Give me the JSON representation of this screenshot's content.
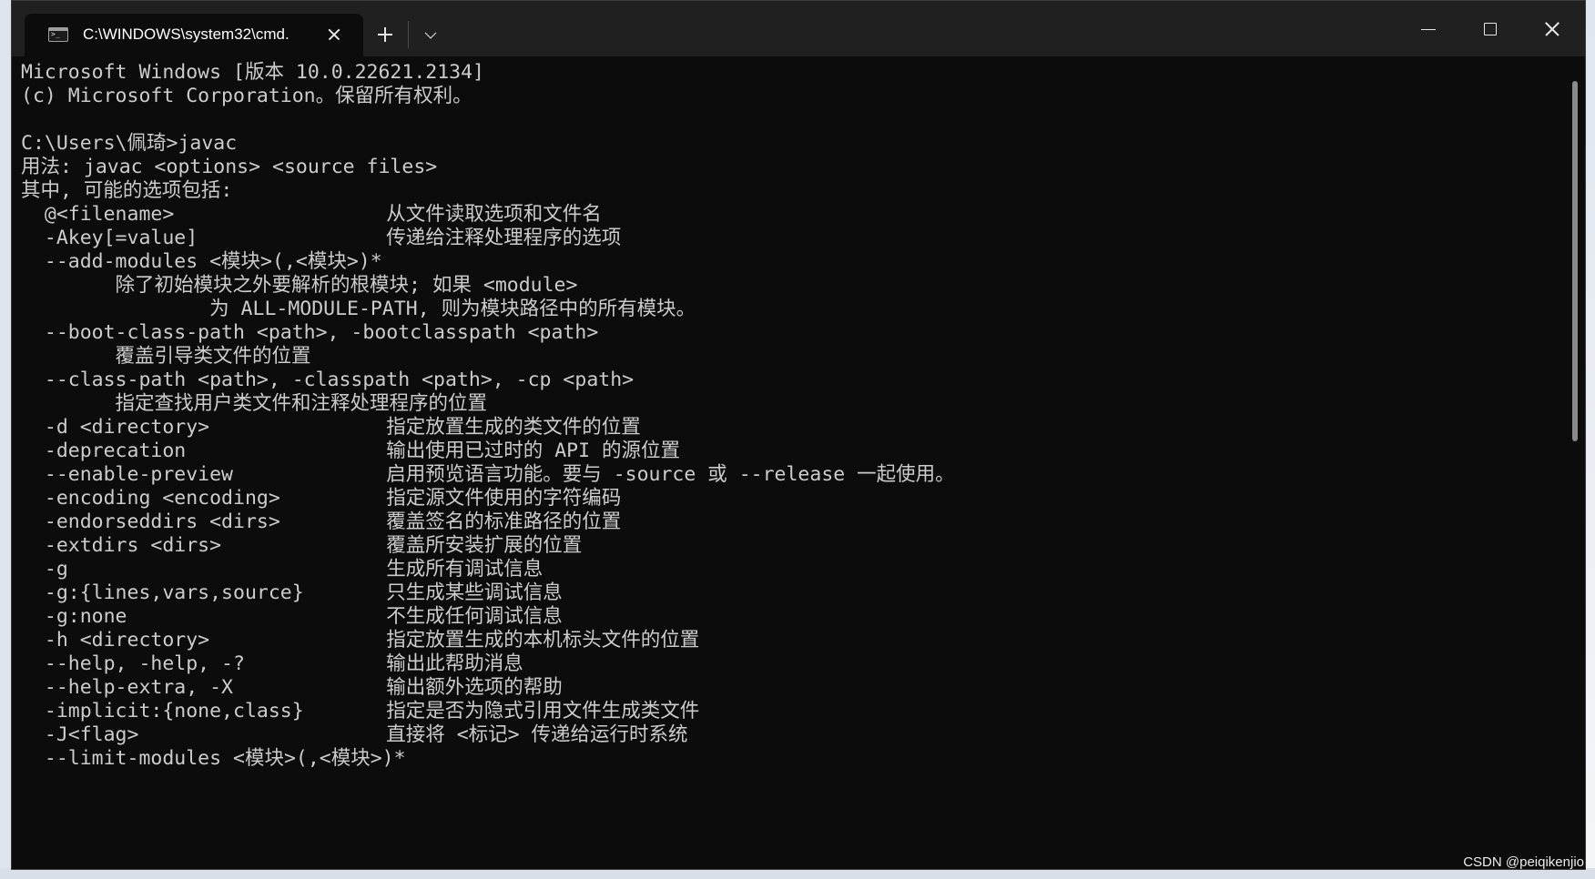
{
  "tab": {
    "title": "C:\\WINDOWS\\system32\\cmd.",
    "icon": "terminal-icon",
    "close_icon": "close-icon"
  },
  "titlebar": {
    "new_tab_icon": "plus-icon",
    "dropdown_icon": "chevron-down-icon",
    "minimize_icon": "minimize-icon",
    "maximize_icon": "maximize-icon",
    "close_icon": "close-icon"
  },
  "terminal": {
    "lines": [
      "Microsoft Windows [版本 10.0.22621.2134]",
      "(c) Microsoft Corporation。保留所有权利。",
      "",
      "C:\\Users\\佩琦>javac",
      "用法: javac <options> <source files>",
      "其中, 可能的选项包括:",
      "  @<filename>                  从文件读取选项和文件名",
      "  -Akey[=value]                传递给注释处理程序的选项",
      "  --add-modules <模块>(,<模块>)*",
      "        除了初始模块之外要解析的根模块; 如果 <module>",
      "                为 ALL-MODULE-PATH, 则为模块路径中的所有模块。",
      "  --boot-class-path <path>, -bootclasspath <path>",
      "        覆盖引导类文件的位置",
      "  --class-path <path>, -classpath <path>, -cp <path>",
      "        指定查找用户类文件和注释处理程序的位置",
      "  -d <directory>               指定放置生成的类文件的位置",
      "  -deprecation                 输出使用已过时的 API 的源位置",
      "  --enable-preview             启用预览语言功能。要与 -source 或 --release 一起使用。",
      "  -encoding <encoding>         指定源文件使用的字符编码",
      "  -endorseddirs <dirs>         覆盖签名的标准路径的位置",
      "  -extdirs <dirs>              覆盖所安装扩展的位置",
      "  -g                           生成所有调试信息",
      "  -g:{lines,vars,source}       只生成某些调试信息",
      "  -g:none                      不生成任何调试信息",
      "  -h <directory>               指定放置生成的本机标头文件的位置",
      "  --help, -help, -?            输出此帮助消息",
      "  --help-extra, -X             输出额外选项的帮助",
      "  -implicit:{none,class}       指定是否为隐式引用文件生成类文件",
      "  -J<flag>                     直接将 <标记> 传递给运行时系统",
      "  --limit-modules <模块>(,<模块>)*"
    ]
  },
  "watermark": "CSDN @peiqikenjio",
  "colors": {
    "terminal_bg": "#0c0c0c",
    "terminal_fg": "#cccccc",
    "titlebar_bg": "#202020"
  }
}
